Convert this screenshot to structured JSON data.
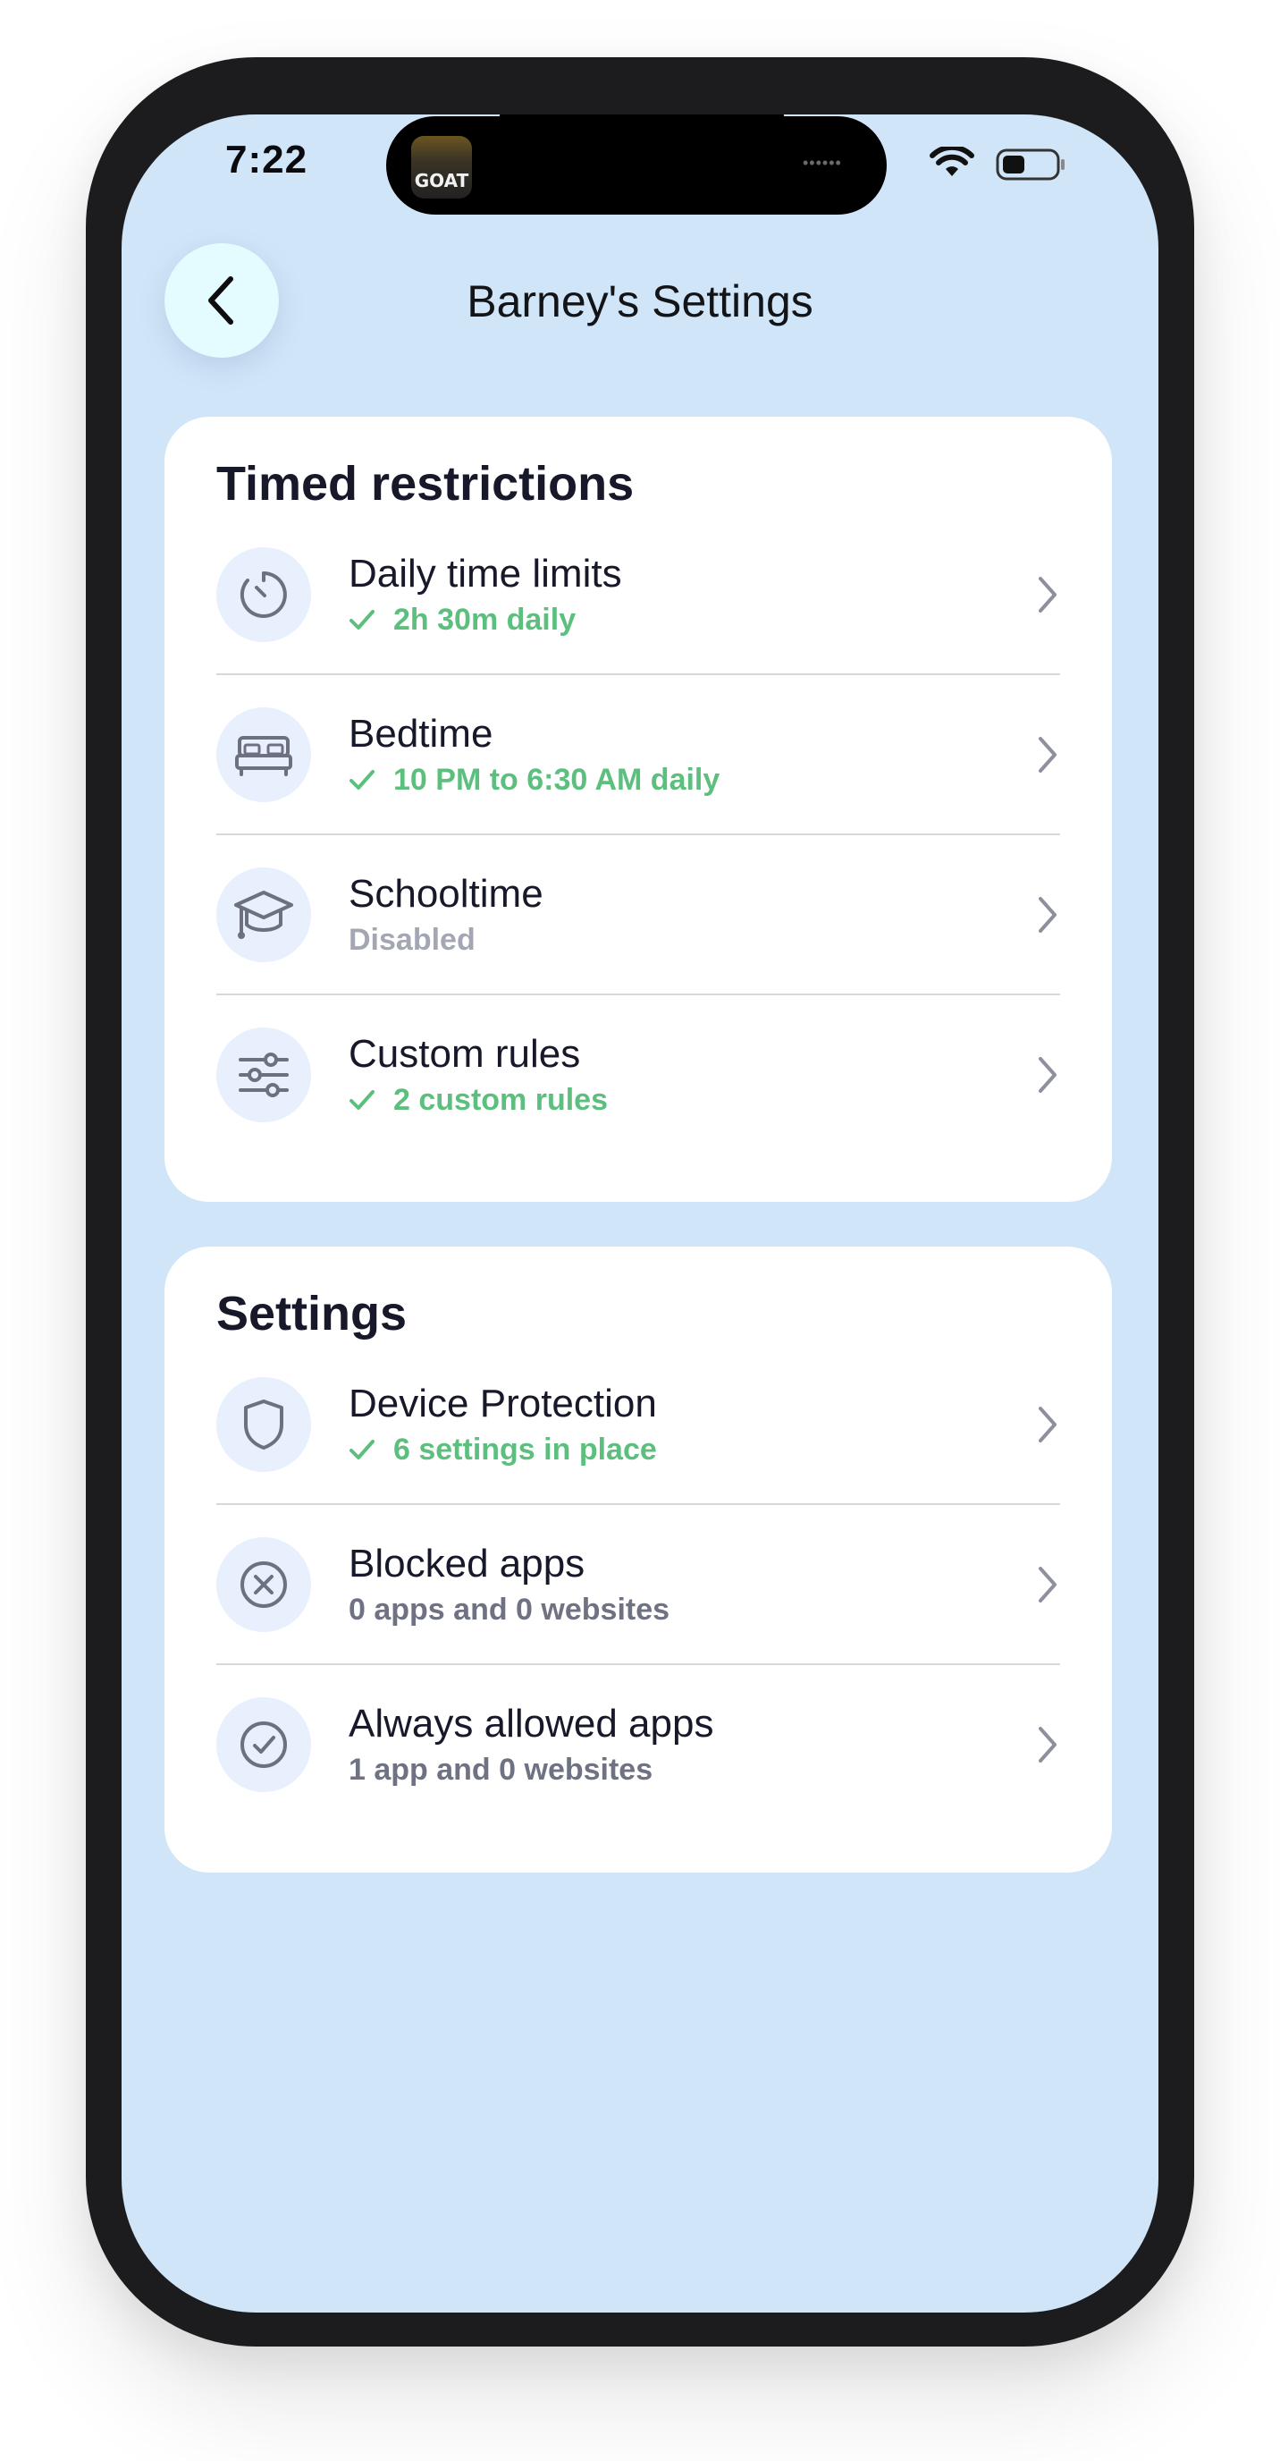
{
  "status_bar": {
    "time": "7:22",
    "island_app_label": "GOAT"
  },
  "header": {
    "title": "Barney's Settings"
  },
  "timed_card": {
    "title": "Timed restrictions",
    "items": [
      {
        "label": "Daily time limits",
        "sub": "2h 30m daily",
        "icon": "timer-icon",
        "state": "ok"
      },
      {
        "label": "Bedtime",
        "sub": "10 PM to 6:30 AM daily",
        "icon": "bed-icon",
        "state": "ok"
      },
      {
        "label": "Schooltime",
        "sub": "Disabled",
        "icon": "graduation-cap-icon",
        "state": "disabled"
      },
      {
        "label": "Custom rules",
        "sub": "2 custom rules",
        "icon": "sliders-icon",
        "state": "ok"
      }
    ]
  },
  "settings_card": {
    "title": "Settings",
    "items": [
      {
        "label": "Device Protection",
        "sub": "6 settings in place",
        "icon": "shield-icon",
        "state": "ok"
      },
      {
        "label": "Blocked apps",
        "sub": "0 apps and 0 websites",
        "icon": "blocked-circle-icon",
        "state": "neutral"
      },
      {
        "label": "Always allowed apps",
        "sub": "1 app and 0 websites",
        "icon": "check-circle-icon",
        "state": "neutral"
      }
    ]
  },
  "colors": {
    "screen_background": "#d1e5f8",
    "card_background": "#ffffff",
    "success_green": "#5cbf7e",
    "icon_background": "#e7f0fc",
    "back_button_background": "#e4fbff"
  }
}
